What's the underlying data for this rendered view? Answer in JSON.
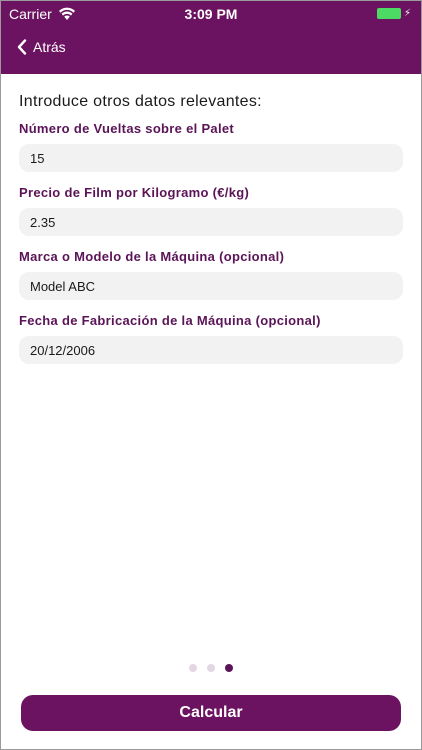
{
  "status_bar": {
    "carrier": "Carrier",
    "time": "3:09 PM",
    "battery_color": "#4cd964",
    "icons": [
      "wifi-icon",
      "battery-icon",
      "charge-icon"
    ]
  },
  "nav": {
    "back_label": "Atrás",
    "background_color": "#6b1361"
  },
  "form": {
    "intro": "Introduce otros datos relevantes:",
    "fields": [
      {
        "label": "Número de Vueltas sobre el Palet",
        "value": "15"
      },
      {
        "label": "Precio de Film por Kilogramo (€/kg)",
        "value": "2.35"
      },
      {
        "label": "Marca o Modelo de la Máquina (opcional)",
        "value": "Model ABC"
      },
      {
        "label": "Fecha de Fabricación de la Máquina (opcional)",
        "value": "20/12/2006"
      }
    ]
  },
  "pager": {
    "total_pages": 3,
    "current_page": 3
  },
  "actions": {
    "calculate_label": "Calcular",
    "accent_color": "#6b1361"
  }
}
